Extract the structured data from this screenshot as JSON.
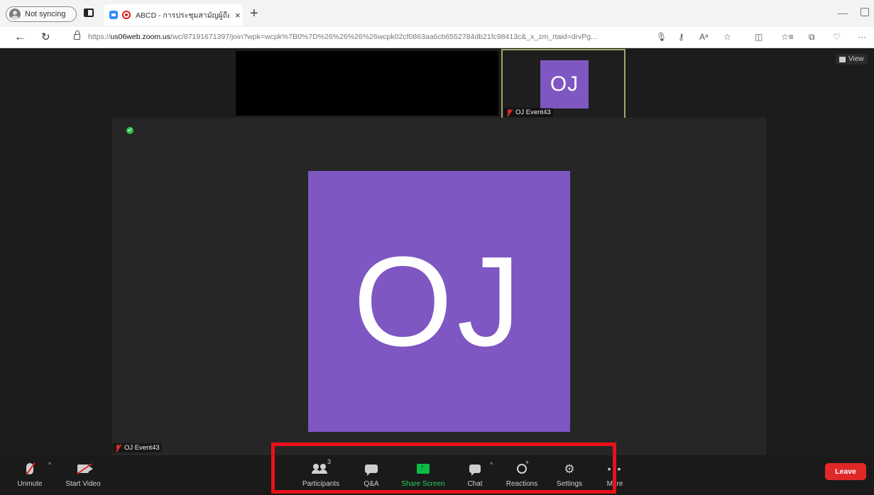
{
  "browser": {
    "profile_label": "Not syncing",
    "tab_title": "ABCD - การประชุมสามัญผู้ถือหุ้น",
    "tab_close": "×",
    "new_tab": "+",
    "url_prefix": "https://",
    "url_host": "us06web.zoom.us",
    "url_rest": "/wc/87191671397/join?wpk=wcpk%7B0%7D%26%26%26%26wcpk02cf0863aa6cb6552784db21fc98413c&_x_zm_rtaid=drvPg..."
  },
  "meeting": {
    "view_label": "View",
    "thumb_initials": "OJ",
    "thumb_name": "OJ Event43",
    "main_initials": "OJ",
    "main_name": "OJ Event43",
    "avatar_color": "#7e57c2"
  },
  "toolbar": {
    "unmute": "Unmute",
    "start_video": "Start Video",
    "participants": "Participants",
    "participants_count": "3",
    "qa": "Q&A",
    "share_screen": "Share Screen",
    "chat": "Chat",
    "reactions": "Reactions",
    "settings": "Settings",
    "more": "More",
    "leave": "Leave",
    "share_color": "#0cbc45",
    "leave_color": "#e02828"
  },
  "annotation": {
    "highlight_color": "#e8101a"
  }
}
